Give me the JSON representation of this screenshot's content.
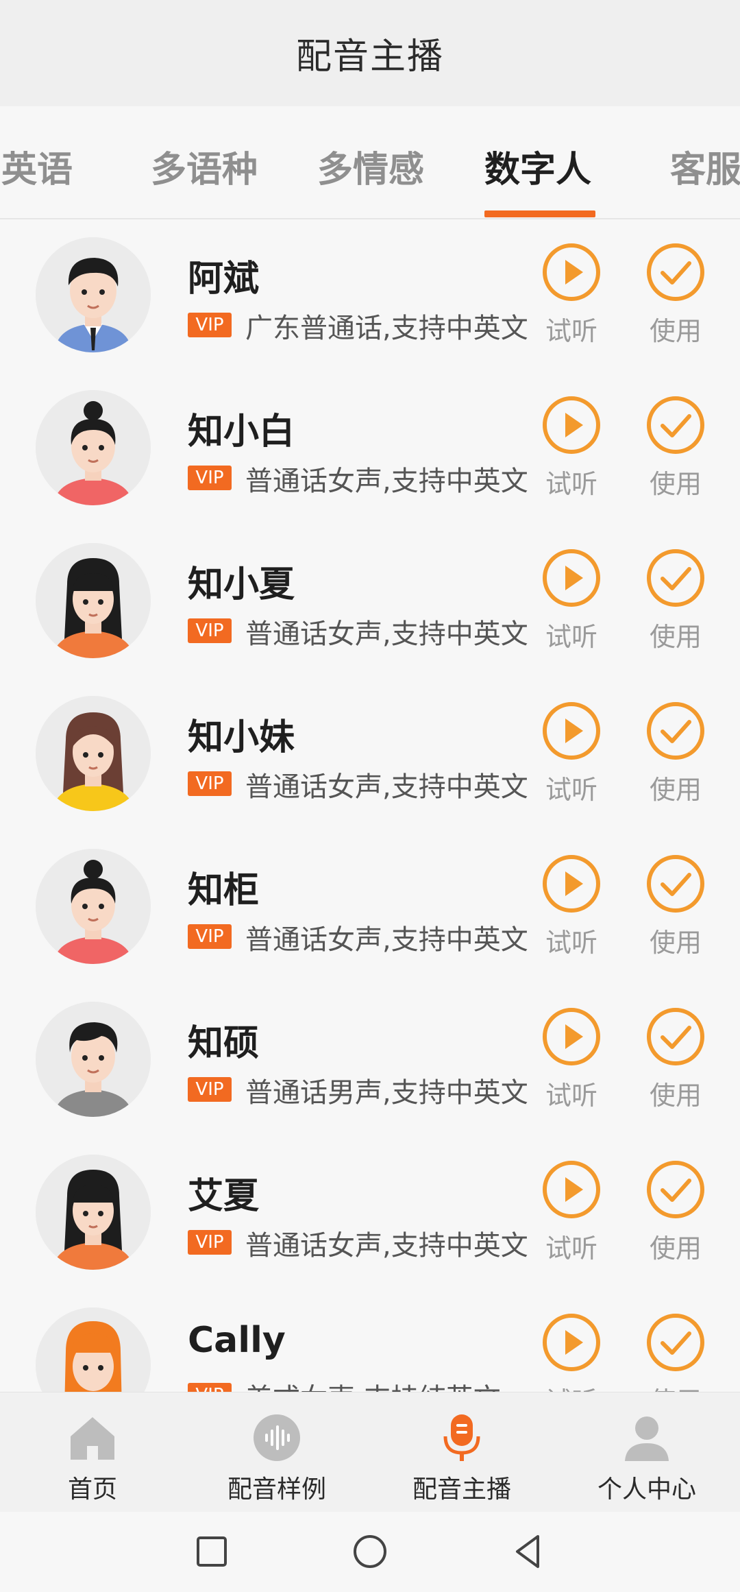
{
  "header": {
    "title": "配音主播"
  },
  "tabs": [
    {
      "label": "英语",
      "active": false
    },
    {
      "label": "多语种",
      "active": false
    },
    {
      "label": "多情感",
      "active": false
    },
    {
      "label": "数字人",
      "active": true
    },
    {
      "label": "客服",
      "active": false
    }
  ],
  "list": {
    "vip_label": "VIP",
    "listen_label": "试听",
    "use_label": "使用",
    "items": [
      {
        "name": "阿斌",
        "description": "广东普通话,支持中英文",
        "avatar_icon": "avatar-man-suit-icon"
      },
      {
        "name": "知小白",
        "description": "普通话女声,支持中英文",
        "avatar_icon": "avatar-woman-bun-red-icon"
      },
      {
        "name": "知小夏",
        "description": "普通话女声,支持中英文",
        "avatar_icon": "avatar-woman-long-hair-orange-icon"
      },
      {
        "name": "知小妹",
        "description": "普通话女声,支持中英文",
        "avatar_icon": "avatar-woman-brown-hair-yellow-icon"
      },
      {
        "name": "知柜",
        "description": "普通话女声,支持中英文",
        "avatar_icon": "avatar-woman-bun-red-icon"
      },
      {
        "name": "知硕",
        "description": "普通话男声,支持中英文",
        "avatar_icon": "avatar-man-gray-shirt-icon"
      },
      {
        "name": "艾夏",
        "description": "普通话女声,支持中英文",
        "avatar_icon": "avatar-woman-long-hair-orange-icon"
      },
      {
        "name": "Cally",
        "description": "美式女声,支持纯英文",
        "avatar_icon": "avatar-woman-orange-hair-icon"
      }
    ]
  },
  "bottom_nav": [
    {
      "label": "首页",
      "icon": "home-icon",
      "active": false
    },
    {
      "label": "配音样例",
      "icon": "waveform-icon",
      "active": false
    },
    {
      "label": "配音主播",
      "icon": "microphone-icon",
      "active": true
    },
    {
      "label": "个人中心",
      "icon": "person-icon",
      "active": false
    }
  ],
  "system_nav": [
    {
      "icon": "recent-apps-icon"
    },
    {
      "icon": "home-circle-icon"
    },
    {
      "icon": "back-triangle-icon"
    }
  ],
  "colors": {
    "accent": "#f26a21",
    "icon_orange": "#f39a2d",
    "nav_gray": "#bdbdbd"
  }
}
